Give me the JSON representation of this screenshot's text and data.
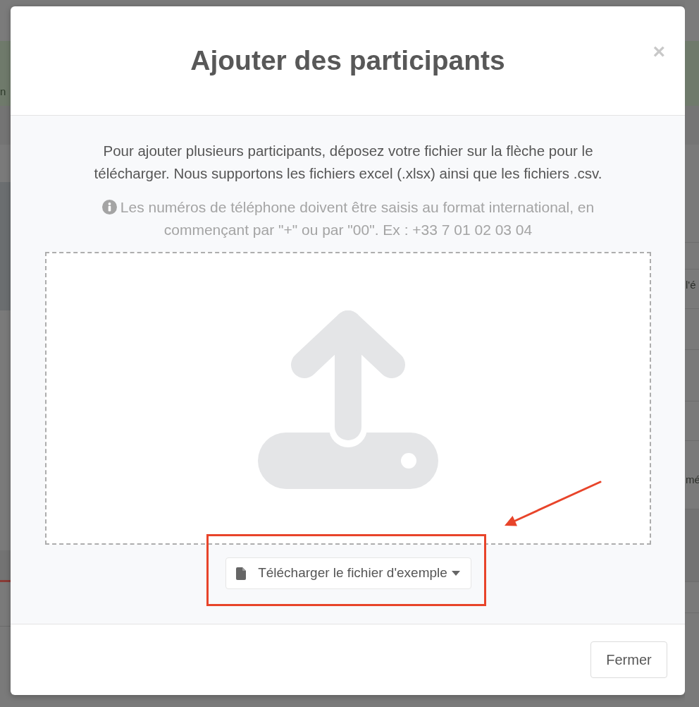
{
  "background_page": {
    "left_edge_texts": [
      "n"
    ],
    "right_edge_texts": [
      "l'é",
      "mé"
    ]
  },
  "dialog": {
    "title": "Ajouter des participants",
    "close": "×",
    "instructions": "Pour ajouter plusieurs participants, déposez votre fichier sur la flèche pour le télécharger. Nous supportons les fichiers excel (.xlsx) ainsi que les fichiers .csv.",
    "note": "Les numéros de téléphone doivent être saisis au format international, en commençant par \"+\" ou par \"00\". Ex : +33 7 01 02 03 04",
    "sample_button": {
      "label": "Télécharger le fichier d'exemple"
    },
    "footer_buttons": [
      "Fermer"
    ]
  },
  "annotations": {
    "frame": true,
    "arrow": true
  }
}
